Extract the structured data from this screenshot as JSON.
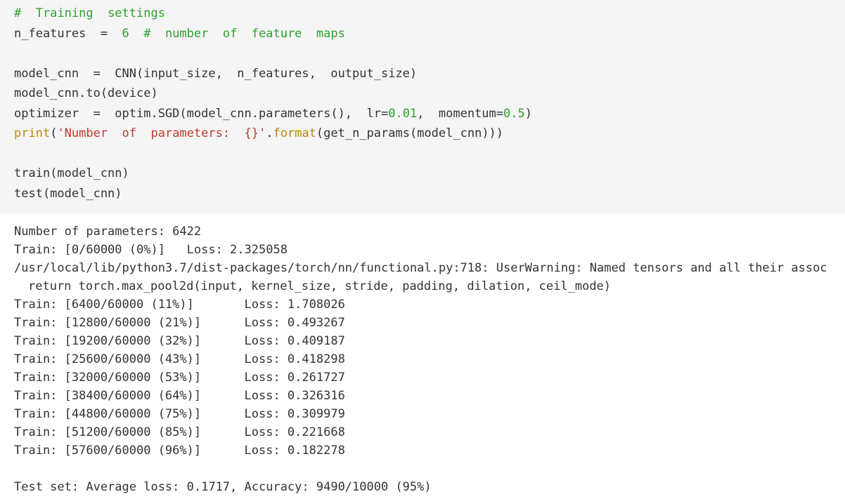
{
  "code": {
    "l1": {
      "comment": "#  Training  settings"
    },
    "l2": {
      "a": "n_features  =  ",
      "num": "6",
      "comment": "  #  number  of  feature  maps"
    },
    "l4": {
      "a": "model_cnn  =  CNN(input_size,  n_features,  output_size)"
    },
    "l5": {
      "a": "model_cnn.to(device)"
    },
    "l6": {
      "a": "optimizer  =  optim.SGD(model_cnn.parameters(),  lr=",
      "n1": "0.01",
      "b": ",  momentum=",
      "n2": "0.5",
      "c": ")"
    },
    "l7": {
      "kw": "print",
      "p1": "(",
      "str": "'Number  of  parameters:  {}'",
      "dot": ".",
      "method": "format",
      "rest": "(get_n_params(model_cnn)))"
    },
    "l9": {
      "a": "train(model_cnn)"
    },
    "l10": {
      "a": "test(model_cnn)"
    }
  },
  "output": {
    "lines": [
      "Number of parameters: 6422",
      "Train: [0/60000 (0%)]   Loss: 2.325058",
      "/usr/local/lib/python3.7/dist-packages/torch/nn/functional.py:718: UserWarning: Named tensors and all their assoc",
      "return torch.max_pool2d(input, kernel_size, stride, padding, dilation, ceil_mode)",
      "Train: [6400/60000 (11%)]       Loss: 1.708026",
      "Train: [12800/60000 (21%)]      Loss: 0.493267",
      "Train: [19200/60000 (32%)]      Loss: 0.409187",
      "Train: [25600/60000 (43%)]      Loss: 0.418298",
      "Train: [32000/60000 (53%)]      Loss: 0.261727",
      "Train: [38400/60000 (64%)]      Loss: 0.326316",
      "Train: [44800/60000 (75%)]      Loss: 0.309979",
      "Train: [51200/60000 (85%)]      Loss: 0.221668",
      "Train: [57600/60000 (96%)]      Loss: 0.182278",
      "Test set: Average loss: 0.1717, Accuracy: 9490/10000 (95%)"
    ]
  }
}
